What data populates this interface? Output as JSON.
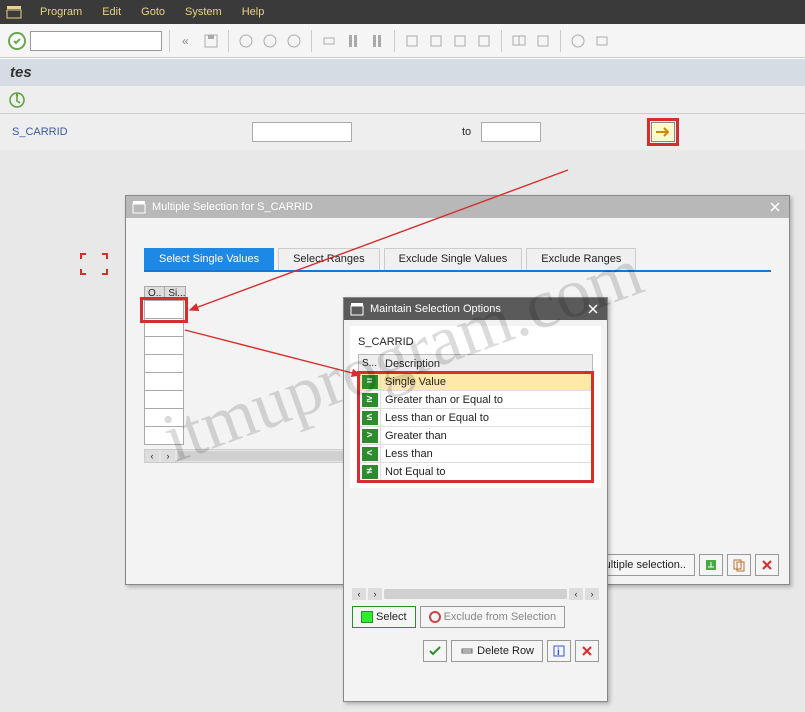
{
  "menubar": {
    "items": [
      {
        "label": "Program",
        "key": "P"
      },
      {
        "label": "Edit",
        "key": "E"
      },
      {
        "label": "Goto",
        "key": "G"
      },
      {
        "label": "System",
        "key": "S"
      },
      {
        "label": "Help",
        "key": "H"
      }
    ]
  },
  "title": "tes",
  "selscreen": {
    "field_label": "S_CARRID",
    "to_label": "to"
  },
  "dialog1": {
    "title": "Multiple Selection for S_CARRID",
    "tabs": [
      "Select Single Values",
      "Select Ranges",
      "Exclude Single Values",
      "Exclude Ranges"
    ],
    "table_headers": [
      "O..",
      "Si..."
    ],
    "footer_button": "Multiple selection.."
  },
  "dialog2": {
    "title": "Maintain Selection Options",
    "field_label": "S_CARRID",
    "headers": [
      "S...",
      "Description"
    ],
    "options": [
      {
        "sym": "=",
        "desc": "Single Value",
        "selected": true
      },
      {
        "sym": "≥",
        "desc": "Greater than or Equal to"
      },
      {
        "sym": "≤",
        "desc": "Less than or Equal to"
      },
      {
        "sym": ">",
        "desc": "Greater than"
      },
      {
        "sym": "<",
        "desc": "Less than"
      },
      {
        "sym": "≠",
        "desc": "Not Equal to"
      }
    ],
    "select_btn": "Select",
    "exclude_btn": "Exclude from Selection",
    "delete_btn": "Delete Row"
  },
  "watermark": "itmuprogram.com"
}
